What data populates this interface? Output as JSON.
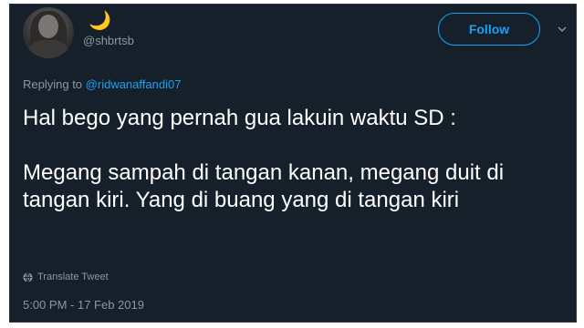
{
  "tweet": {
    "display_name": "🌙",
    "handle": "@shbrtsb",
    "follow_label": "Follow",
    "replying_to_prefix": "Replying to",
    "replying_to_handle": "@ridwanaffandi07",
    "text_line_1": "Hal bego yang pernah gua lakuin waktu SD :",
    "text_line_2": "Megang sampah di tangan kanan, megang duit di tangan kiri. Yang di buang yang di tangan kiri",
    "translate_label": "Translate Tweet",
    "timestamp": "5:00 PM - 17 Feb 2019"
  },
  "icons": {
    "menu": "chevron-down-icon",
    "translate": "globe-icon"
  },
  "colors": {
    "background": "#15202b",
    "accent": "#1da1f2",
    "text": "#ffffff",
    "muted": "#8899a6"
  }
}
